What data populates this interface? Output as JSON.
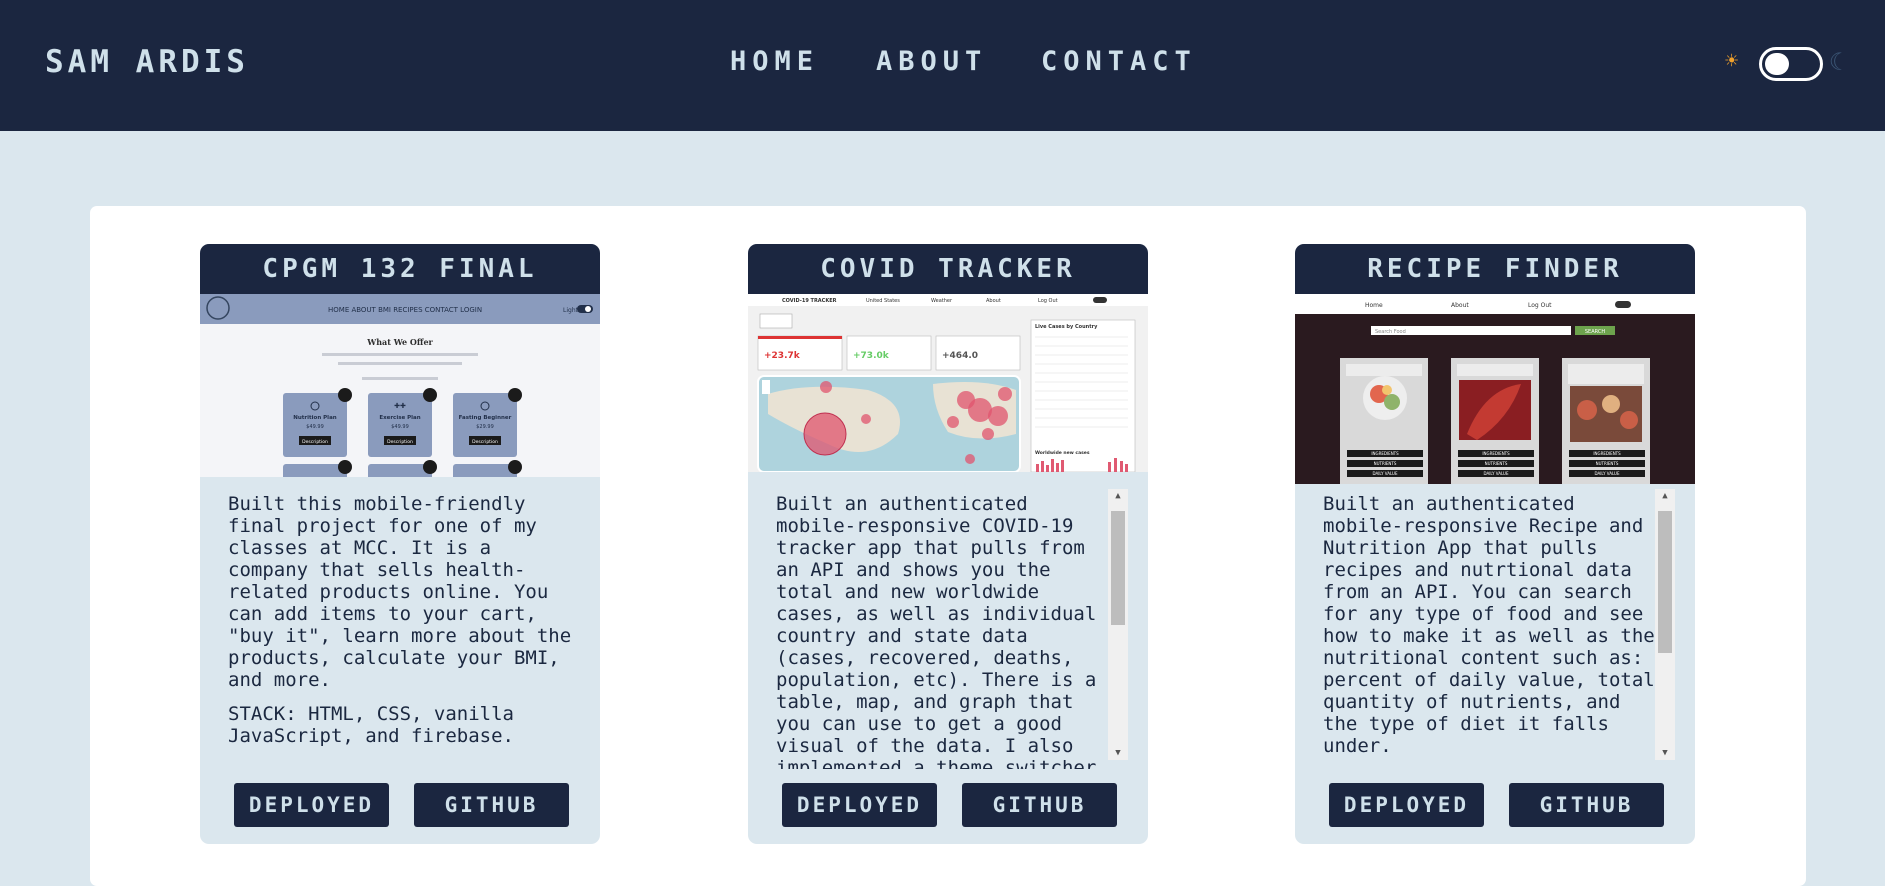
{
  "header": {
    "brand": "SAM ARDIS",
    "nav": {
      "home": "HOME",
      "about": "ABOUT",
      "contact": "CONTACT"
    },
    "theme_toggle": {
      "sun_icon": "☀",
      "moon_icon": "☾",
      "state": "light"
    }
  },
  "projects": [
    {
      "title": "CPGM 132 FINAL",
      "description": "Built this mobile-friendly final project for one of my classes at MCC. It is a company that sells health-related products online. You can add items to your cart, \"buy it\", learn more about the products, calculate your BMI, and more.",
      "stack": "STACK: HTML, CSS, vanilla JavaScript, and firebase.",
      "buttons": {
        "deployed": "DEPLOYED",
        "github": "GITHUB"
      },
      "screenshot": {
        "nav": "HOME ABOUT BMI RECIPES CONTACT LOGIN",
        "heading": "What We Offer",
        "plans": [
          "Nutrition Plan",
          "Exercise Plan",
          "Fasting Beginner"
        ],
        "prices": [
          "$49.99",
          "$49.99",
          "$29.99"
        ],
        "button": "Description"
      }
    },
    {
      "title": "COVID TRACKER",
      "description": "Built an authenticated mobile-responsive COVID-19 tracker app that pulls from an API and shows you the total and new worldwide cases, as well as individual country and state data (cases, recovered, deaths, population, etc). There is a table, map, and graph that you can use to get a good visual of the data. I also implemented a theme switcher.",
      "buttons": {
        "deployed": "DEPLOYED",
        "github": "GITHUB"
      },
      "screenshot": {
        "nav": [
          "COVID-19 TRACKER",
          "United States",
          "Weather",
          "About",
          "Log Out"
        ],
        "stats": [
          "+23.7k",
          "+73.0k",
          "+464.0"
        ],
        "table_title": "Live Cases by Country",
        "graph_title": "Worldwide new cases"
      }
    },
    {
      "title": "RECIPE FINDER",
      "description": "Built an authenticated mobile-responsive Recipe and Nutrition App that pulls recipes and nutrtional data from an API. You can search for any type of food and see how to make it as well as the nutritional content such as: percent of daily value, total quantity of nutrients, and the type of diet it falls under.",
      "buttons": {
        "deployed": "DEPLOYED",
        "github": "GITHUB"
      },
      "screenshot": {
        "nav": [
          "Home",
          "About",
          "Log Out"
        ],
        "search_placeholder": "Search Food",
        "search_button": "SEARCH",
        "card_labels": [
          "INGREDIENTS",
          "NUTRIENTS",
          "DAILY VALUE"
        ]
      }
    }
  ],
  "colors": {
    "navy": "#1b2640",
    "background": "#dbe7ee",
    "nav_text": "#cfe0ea",
    "sun": "#f0a02b"
  }
}
